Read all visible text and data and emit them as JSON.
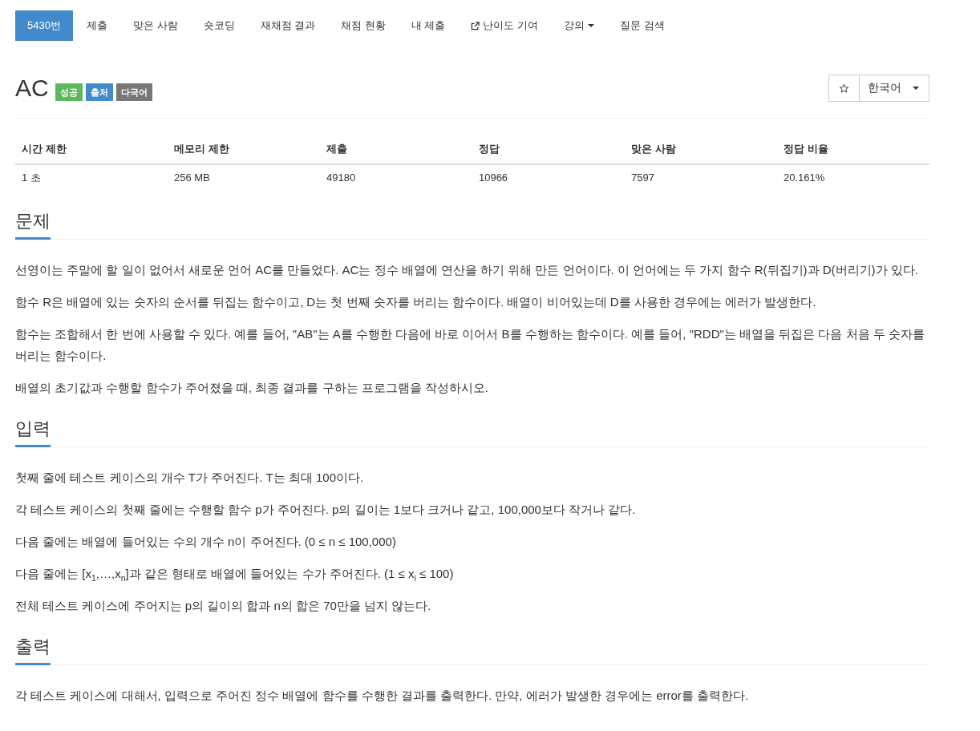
{
  "nav": {
    "tabs": [
      {
        "label": "5430번",
        "selected": true,
        "kind": "plain"
      },
      {
        "label": "제출",
        "selected": false,
        "kind": "plain"
      },
      {
        "label": "맞은 사람",
        "selected": false,
        "kind": "plain"
      },
      {
        "label": "숏코딩",
        "selected": false,
        "kind": "plain"
      },
      {
        "label": "재채점 결과",
        "selected": false,
        "kind": "plain"
      },
      {
        "label": "채점 현황",
        "selected": false,
        "kind": "plain"
      },
      {
        "label": "내 제출",
        "selected": false,
        "kind": "plain"
      },
      {
        "label": "난이도 기여",
        "selected": false,
        "kind": "external"
      },
      {
        "label": "강의",
        "selected": false,
        "kind": "dropdown"
      },
      {
        "label": "질문 검색",
        "selected": false,
        "kind": "plain"
      }
    ]
  },
  "problem": {
    "title": "AC",
    "labels": [
      {
        "text": "성공",
        "color": "#5cb85c"
      },
      {
        "text": "출처",
        "color": "#428bca"
      },
      {
        "text": "다국어",
        "color": "#777777"
      }
    ]
  },
  "language_selector": {
    "value": "한국어"
  },
  "limits_table": {
    "columns": [
      "시간 제한",
      "메모리 제한",
      "제출",
      "정답",
      "맞은 사람",
      "정답 비율"
    ],
    "rows": [
      [
        "1 초",
        "256 MB",
        "49180",
        "10966",
        "7597",
        "20.161%"
      ]
    ]
  },
  "sections": [
    {
      "title": "문제",
      "paragraphs": [
        "선영이는 주말에 할 일이 없어서 새로운 언어 AC를 만들었다. AC는 정수 배열에 연산을 하기 위해 만든 언어이다. 이 언어에는 두 가지 함수 R(뒤집기)과 D(버리기)가 있다.",
        "함수 R은 배열에 있는 숫자의 순서를 뒤집는 함수이고, D는 첫 번째 숫자를 버리는 함수이다. 배열이 비어있는데 D를 사용한 경우에는 에러가 발생한다.",
        "함수는 조합해서 한 번에 사용할 수 있다. 예를 들어, \"AB\"는 A를 수행한 다음에 바로 이어서 B를 수행하는 함수이다. 예를 들어, \"RDD\"는 배열을 뒤집은 다음 처음 두 숫자를 버리는 함수이다.",
        "배열의 초기값과 수행할 함수가 주어졌을 때, 최종 결과를 구하는 프로그램을 작성하시오."
      ]
    },
    {
      "title": "입력",
      "paragraphs": [
        "첫째 줄에 테스트 케이스의 개수 T가 주어진다. T는 최대 100이다.",
        "각 테스트 케이스의 첫째 줄에는 수행할 함수 p가 주어진다. p의 길이는 1보다 크거나 같고, 100,000보다 작거나 같다.",
        "다음 줄에는 배열에 들어있는 수의 개수 n이 주어진다. (0 ≤ n ≤ 100,000)",
        "다음 줄에는 [x$_{1}$,…,x$_{n}$]과 같은 형태로 배열에 들어있는 수가 주어진다. (1 ≤ x$_{i}$ ≤ 100)",
        "전체 테스트 케이스에 주어지는 p의 길이의 합과 n의 합은 70만을 넘지 않는다."
      ]
    },
    {
      "title": "출력",
      "paragraphs": [
        "각 테스트 케이스에 대해서, 입력으로 주어진 정수 배열에 함수를 수행한 결과를 출력한다. 만약, 에러가 발생한 경우에는 error를 출력한다."
      ]
    }
  ]
}
